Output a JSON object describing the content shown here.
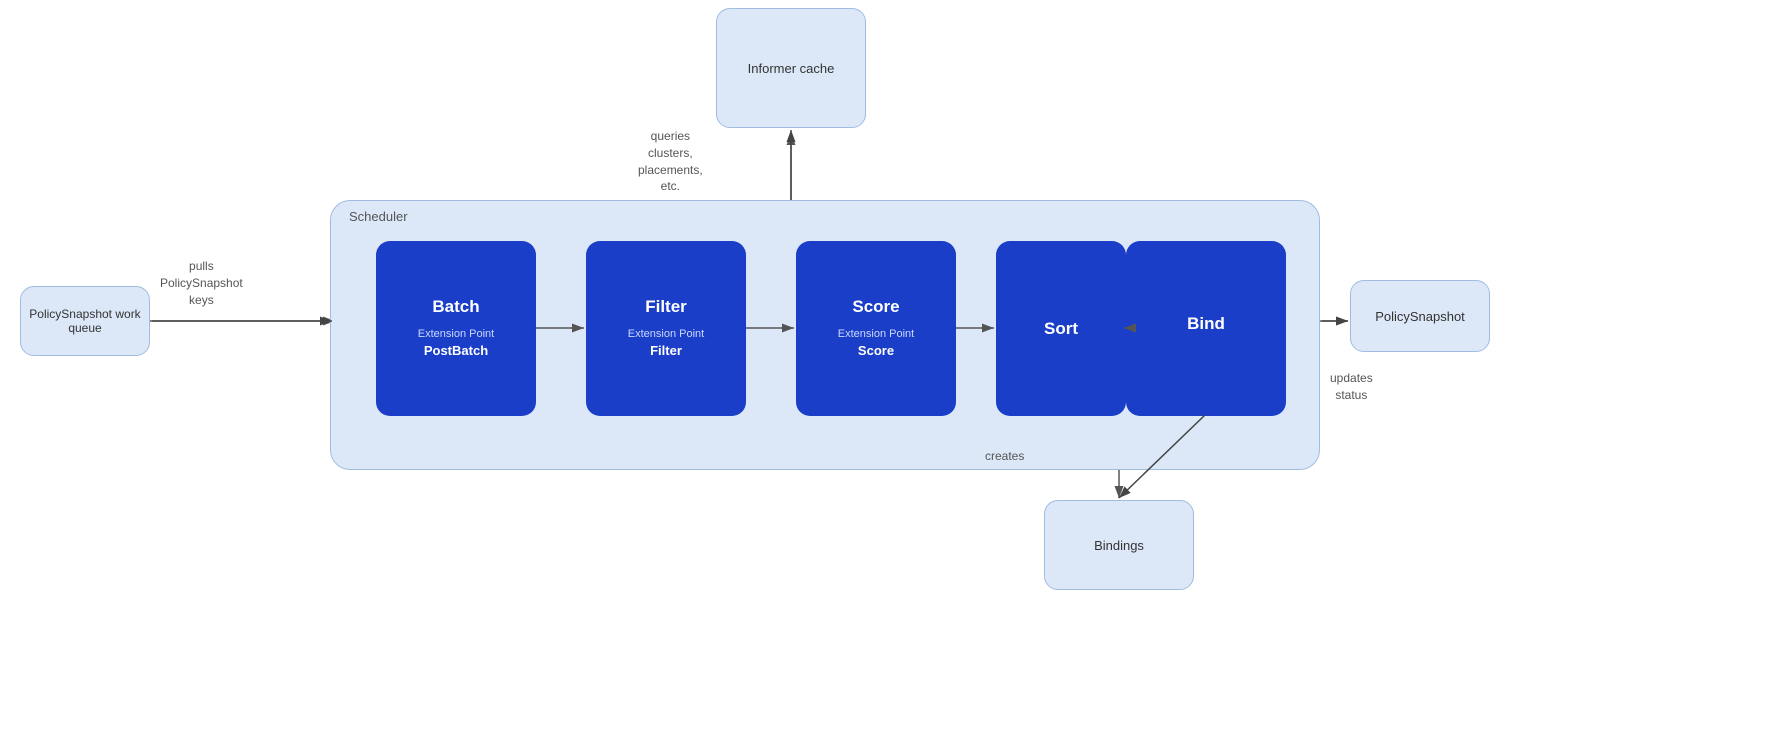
{
  "informer_cache": {
    "label": "Informer cache"
  },
  "work_queue": {
    "label": "PolicySnapshot work queue"
  },
  "policy_snapshot_out": {
    "label": "PolicySnapshot"
  },
  "bindings": {
    "label": "Bindings"
  },
  "scheduler": {
    "label": "Scheduler"
  },
  "process_boxes": [
    {
      "id": "batch",
      "title": "Batch",
      "sub": "Extension Point",
      "sub_bold": "PostBatch"
    },
    {
      "id": "filter",
      "title": "Filter",
      "sub": "Extension Point",
      "sub_bold": "Filter"
    },
    {
      "id": "score",
      "title": "Score",
      "sub": "Extension Point",
      "sub_bold": "Score"
    },
    {
      "id": "sort",
      "title": "Sort",
      "sub": "",
      "sub_bold": ""
    },
    {
      "id": "bind",
      "title": "Bind",
      "sub": "",
      "sub_bold": ""
    }
  ],
  "arrow_labels": {
    "pulls": "pulls\nPolicySnapshot\nkeys",
    "queries": "queries\nclusters,\nplacements,\netc.",
    "creates": "creates",
    "updates_status": "updates\nstatus"
  }
}
